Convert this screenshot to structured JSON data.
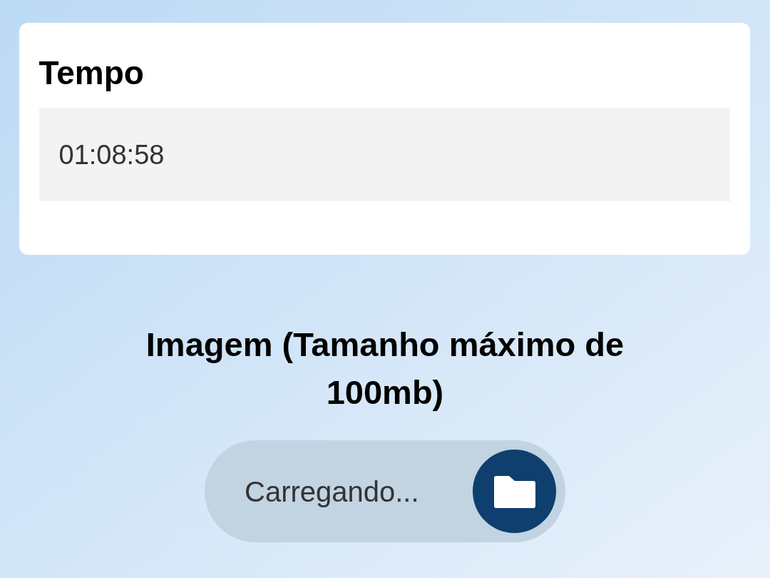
{
  "time_card": {
    "title": "Tempo",
    "value": "01:08:58"
  },
  "image_upload": {
    "title": "Imagem (Tamanho máximo de 100mb)",
    "button_label": "Carregando..."
  }
}
